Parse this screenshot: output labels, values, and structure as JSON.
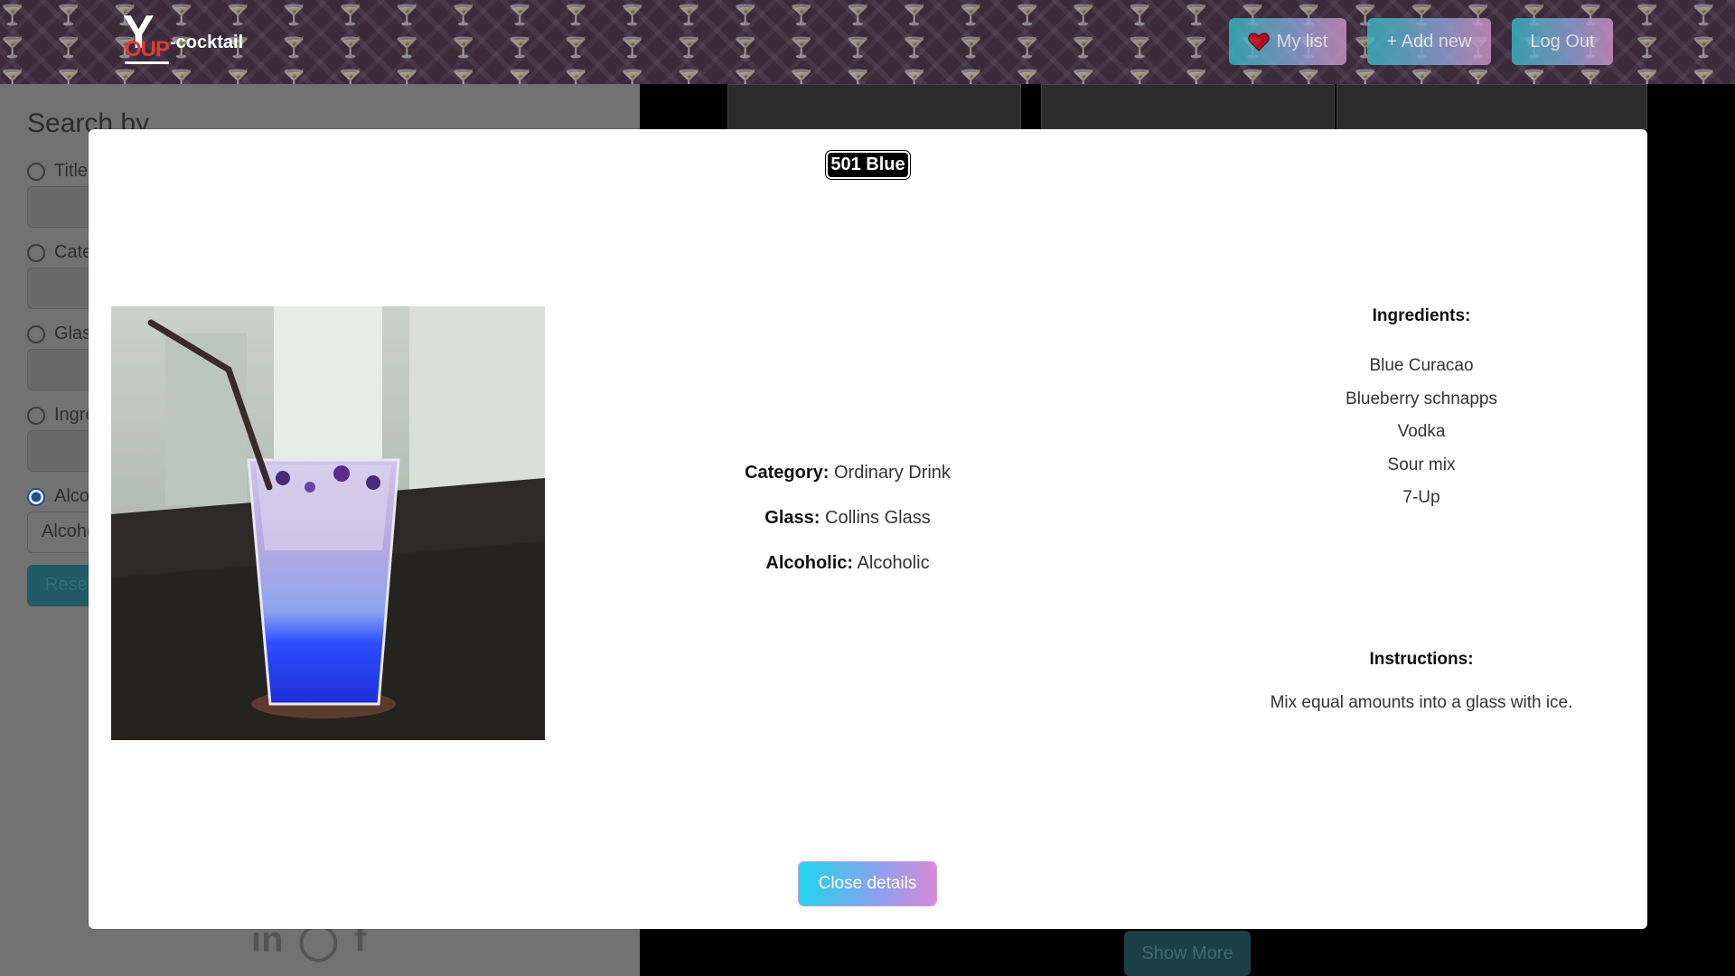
{
  "header": {
    "logo_big": "Y",
    "logo_small": "OUP",
    "logo_word": "-cocktail",
    "my_list_label": "My list",
    "add_new_label": "+ Add new",
    "logout_label": "Log Out"
  },
  "sidebar": {
    "search_title": "Search by",
    "options": [
      {
        "label": "Title",
        "checked": false
      },
      {
        "label": "Category",
        "checked": false
      },
      {
        "label": "Glass",
        "checked": false
      },
      {
        "label": "Ingredient",
        "checked": false
      },
      {
        "label": "Alcoholic",
        "checked": true
      }
    ],
    "select_value": "Alcoholic",
    "reset_label": "Reset"
  },
  "results": {
    "show_more_label": "Show More"
  },
  "modal": {
    "title": "501 Blue",
    "category_label": "Category:",
    "category_value": "Ordinary Drink",
    "glass_label": "Glass:",
    "glass_value": "Collins Glass",
    "alcoholic_label": "Alcoholic:",
    "alcoholic_value": "Alcoholic",
    "ingredients_title": "Ingredients:",
    "ingredients": [
      "Blue Curacao",
      "Blueberry schnapps",
      "Vodka",
      "Sour mix",
      "7-Up"
    ],
    "instructions_title": "Instructions:",
    "instructions": "Mix equal amounts into a glass with ice.",
    "close_label": "Close details"
  },
  "colors": {
    "accent_gradient_start": "#21d4ef",
    "accent_gradient_end": "#d88ad4",
    "title_bg": "#000000",
    "heart": "#d0021b"
  }
}
